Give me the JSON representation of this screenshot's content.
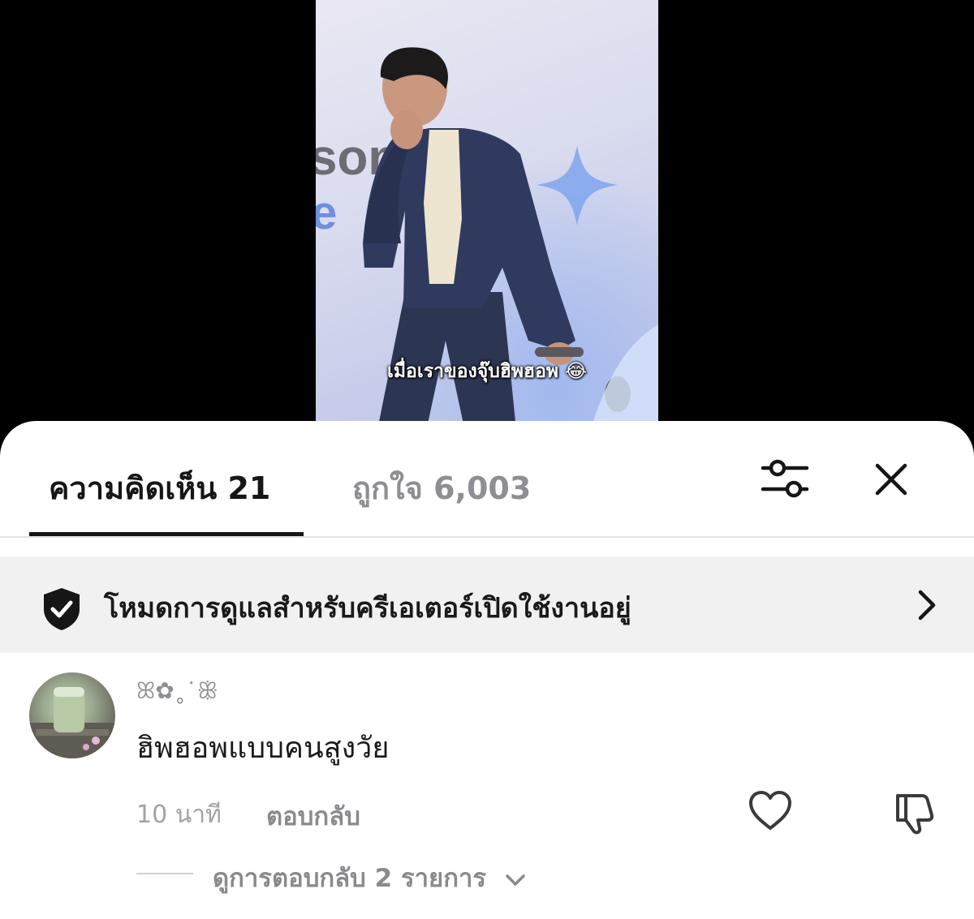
{
  "video": {
    "caption": "เมื่อเราของจุ๊บฮิพฮอพ",
    "caption_emoji": "😂",
    "background_letters": "son",
    "background_letter2": "e"
  },
  "sheet": {
    "tabs": [
      {
        "label": "ความคิดเห็น 21",
        "active": true
      },
      {
        "label": "ถูกใจ 6,003",
        "active": false
      }
    ],
    "filter_icon": "sliders-icon",
    "close_icon": "close-icon"
  },
  "banner": {
    "icon": "shield-check-icon",
    "text": "โหมดการดูแลสำหรับครีเอเตอร์เปิดใช้งานอยู่",
    "chevron": "chevron-right-icon"
  },
  "comment": {
    "username": "ꕤ✿˳˙ꕥ",
    "text": "ฮิพฮอพแบบคนสูงวัย",
    "timestamp": "10 นาที",
    "reply_label": "ตอบกลับ",
    "view_replies_label": "ดูการตอบกลับ 2 รายการ"
  },
  "colors": {
    "text_primary": "#161616",
    "text_secondary": "#8e8e93",
    "banner_bg": "#f1f1f2"
  }
}
